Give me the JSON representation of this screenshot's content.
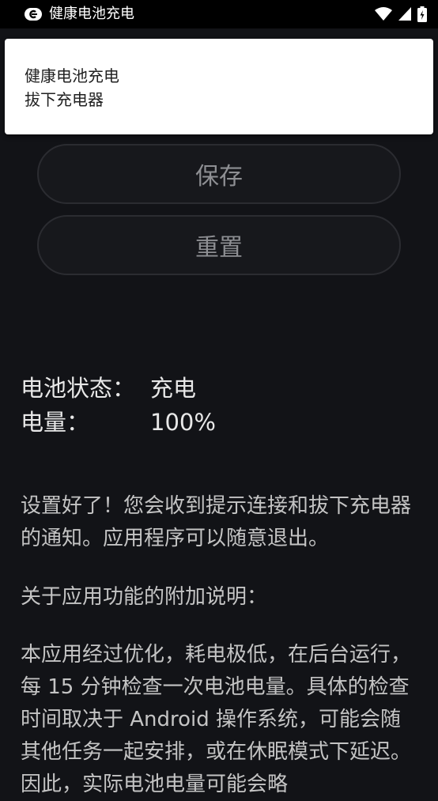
{
  "status_bar": {
    "title": "健康电池充电",
    "icons": [
      "app-c-icon",
      "wifi-icon",
      "cell-signal-icon",
      "battery-icon"
    ]
  },
  "notification": {
    "title": "健康电池充电",
    "text": "拔下充电器"
  },
  "buttons": {
    "save": "保存",
    "reset": "重置"
  },
  "battery_info": {
    "status_label": "电池状态：",
    "status_value": "充电",
    "level_label": "电量：",
    "level_value": "100%"
  },
  "description": {
    "para1": "设置好了！您会收到提示连接和拔下充电器的通知。应用程序可以随意退出。",
    "para2": "关于应用功能的附加说明：",
    "para3": "本应用经过优化，耗电极低，在后台运行，每 15 分钟检查一次电池电量。具体的检查时间取决于 Android 操作系统，可能会随其他任务一起安排，或在休眠模式下延迟。因此，实际电池电量可能会略"
  },
  "colors": {
    "background": "#121317",
    "notification_bg": "#ffffff",
    "button_border": "#2b2c31",
    "button_text": "#8e8f93"
  }
}
